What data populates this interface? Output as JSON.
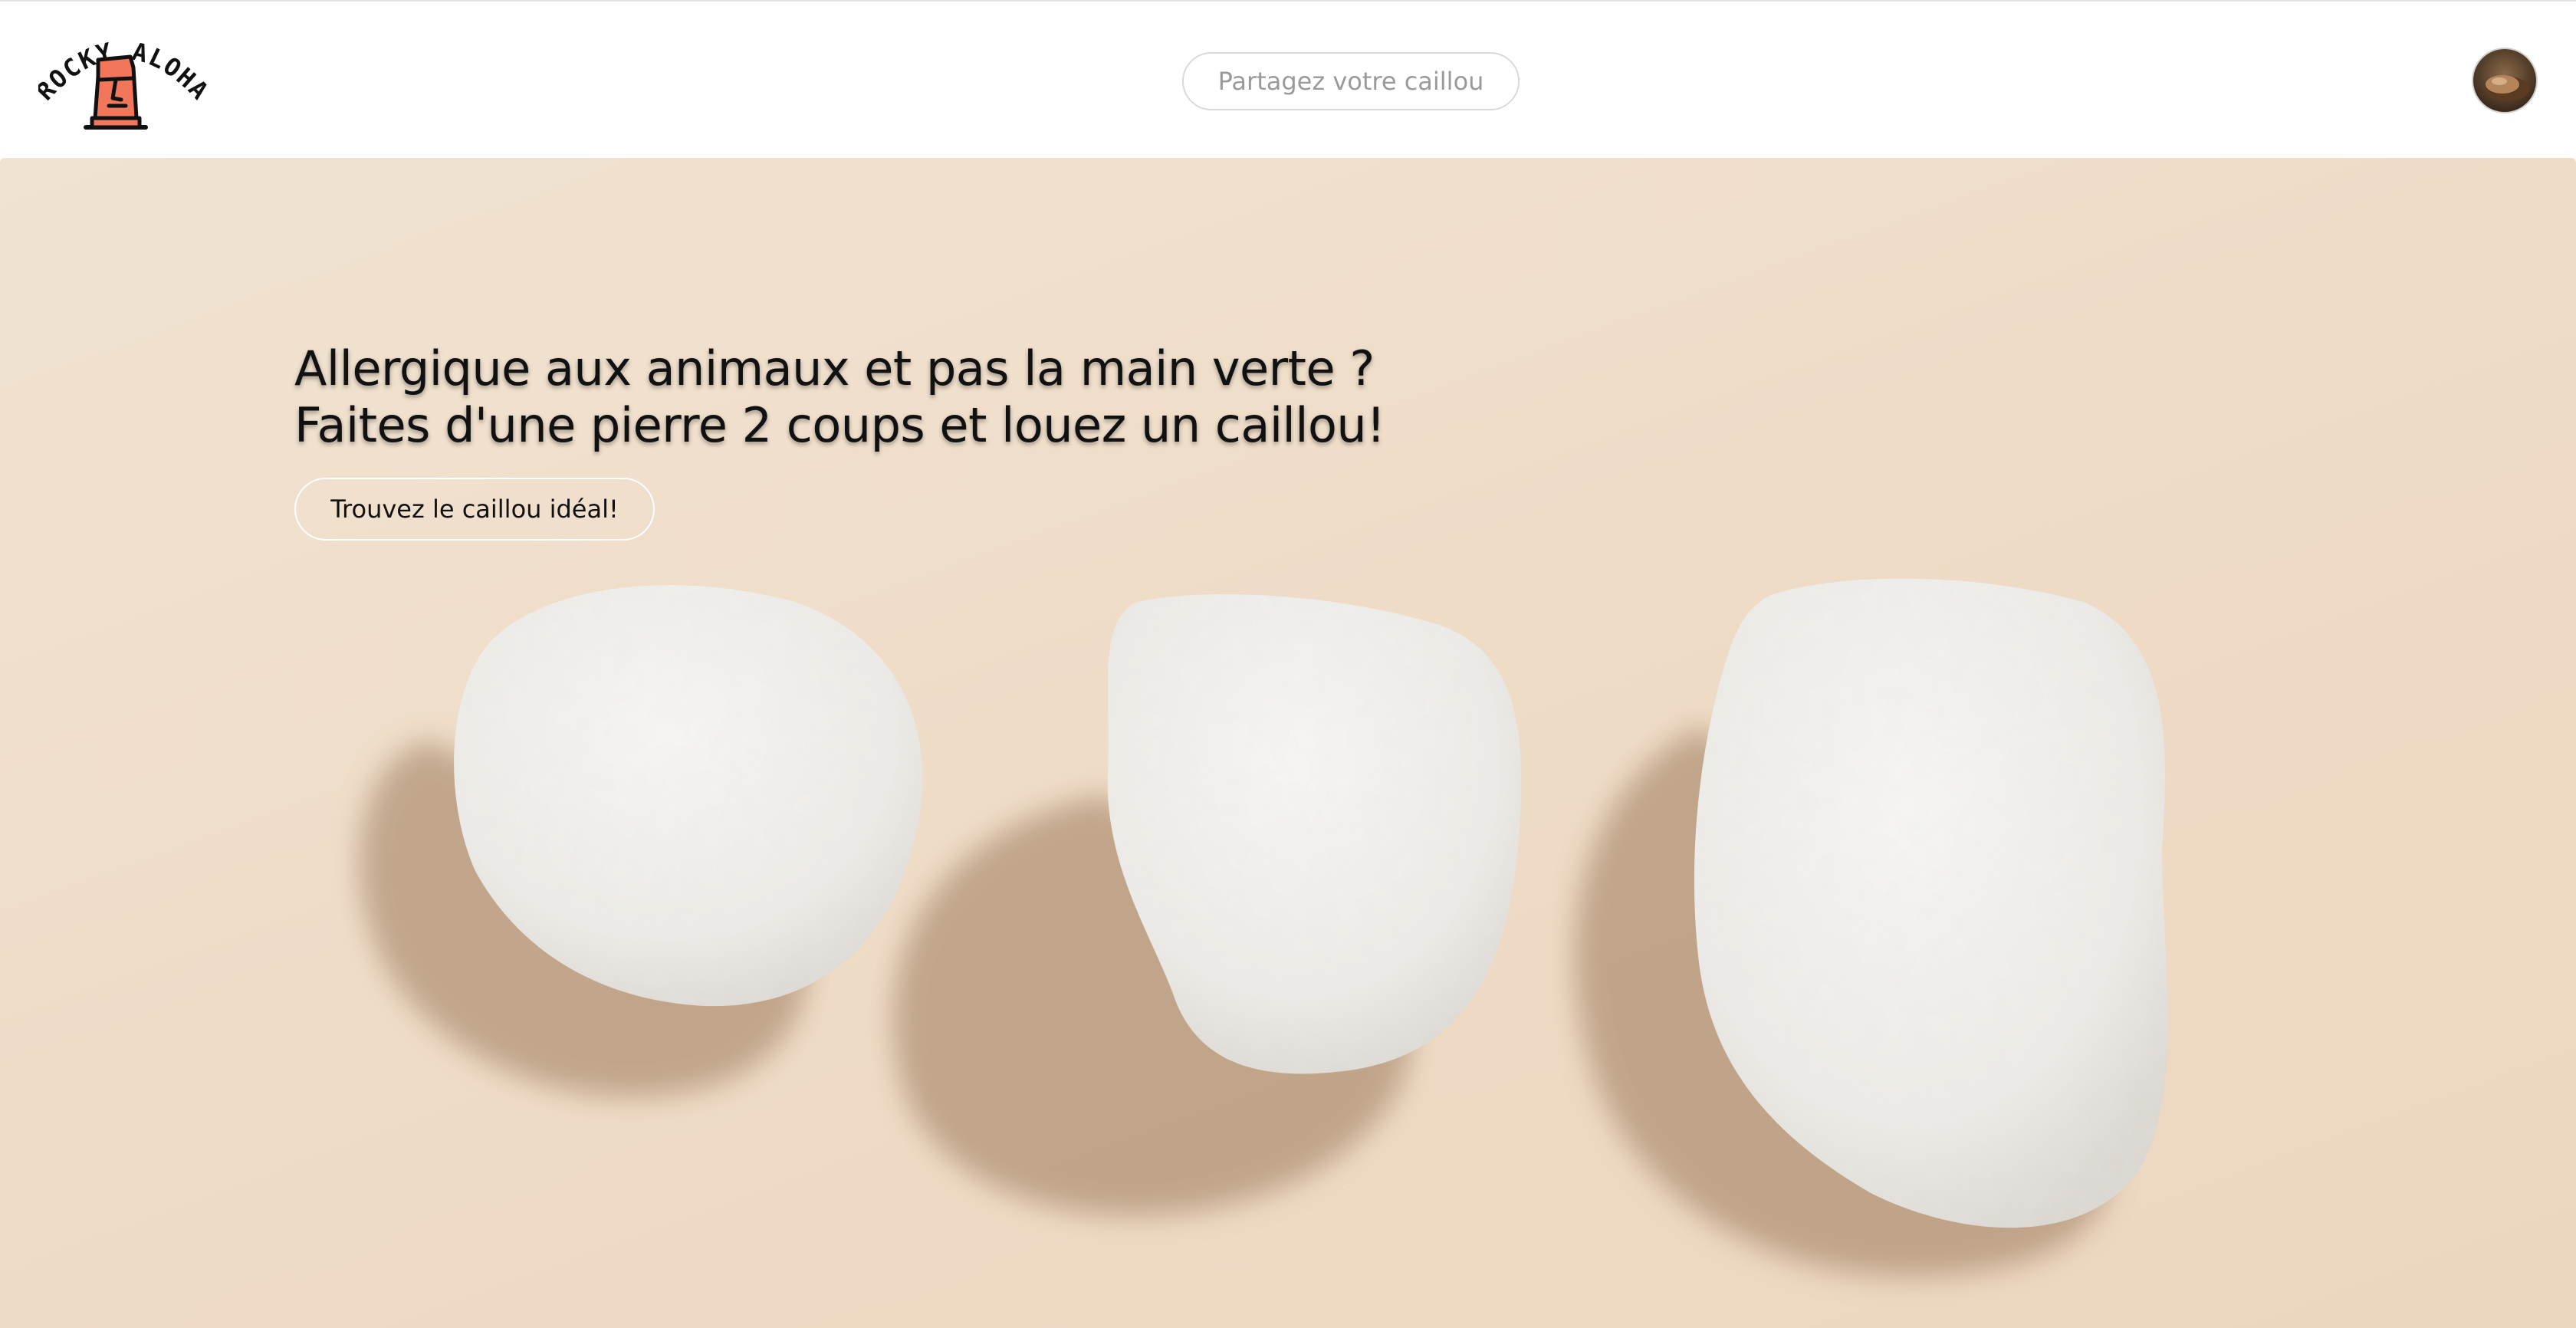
{
  "header": {
    "logo_text": "ROCKY ALOHA",
    "share_button_label": "Partagez votre caillou"
  },
  "hero": {
    "title_line_1": "Allergique aux animaux et pas la main verte ?",
    "title_line_2": "Faites d'une pierre 2 coups et louez un caillou!",
    "cta_label": "Trouvez le caillou idéal!"
  },
  "icons": {
    "logo": "moai-statue-logo",
    "avatar": "user-avatar"
  },
  "colors": {
    "logo_accent": "#f2775a",
    "hero_background": "#efdcc7",
    "text_dark": "#111111"
  }
}
